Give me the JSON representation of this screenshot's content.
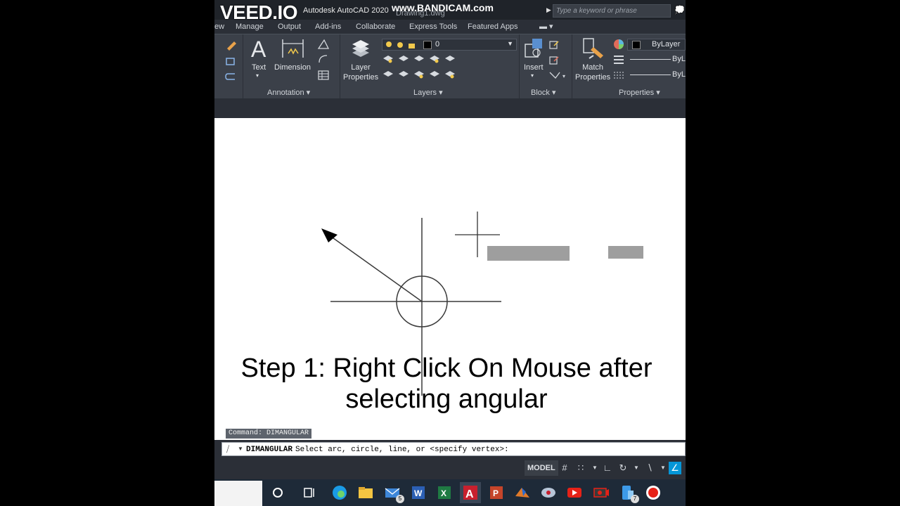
{
  "watermark": {
    "veed": "VEED.IO",
    "bandicam": "www.BANDICAM.com"
  },
  "titlebar": {
    "app_title": "Autodesk AutoCAD 2020",
    "drawing": "Drawing1.dwg",
    "search_placeholder": "Type a keyword or phrase"
  },
  "tabs": [
    "ew",
    "Manage",
    "Output",
    "Add-ins",
    "Collaborate",
    "Express Tools",
    "Featured Apps"
  ],
  "ribbon": {
    "annotation": {
      "text_label": "Text",
      "dimension_label": "Dimension",
      "panel_title": "Annotation ▾"
    },
    "layers": {
      "layer_properties_label": "Layer\nProperties",
      "current_layer": "0",
      "panel_title": "Layers ▾"
    },
    "block": {
      "insert_label": "Insert",
      "panel_title": "Block ▾"
    },
    "properties": {
      "match_label": "Match\nProperties",
      "color_value": "ByLayer",
      "linetype_value": "ByLa",
      "lineweight_value": "ByLa",
      "panel_title": "Properties ▾"
    }
  },
  "canvas": {
    "caption_line1": "Step 1: Right Click On Mouse after",
    "caption_line2": "selecting angular"
  },
  "command": {
    "history": "Command:  DIMANGULAR",
    "name": "DIMANGULAR",
    "prompt": "Select arc, circle, line, or <specify vertex>:"
  },
  "status": {
    "model": "MODEL"
  },
  "taskbar": {
    "mail_badge": "5",
    "files_badge": "7"
  },
  "colors": {
    "ribbon_bg": "#3b4049",
    "dark_bg": "#2b2f37",
    "canvas_bg": "#ffffff",
    "accent": "#0696d7",
    "preview_gray": "#9e9e9e"
  }
}
